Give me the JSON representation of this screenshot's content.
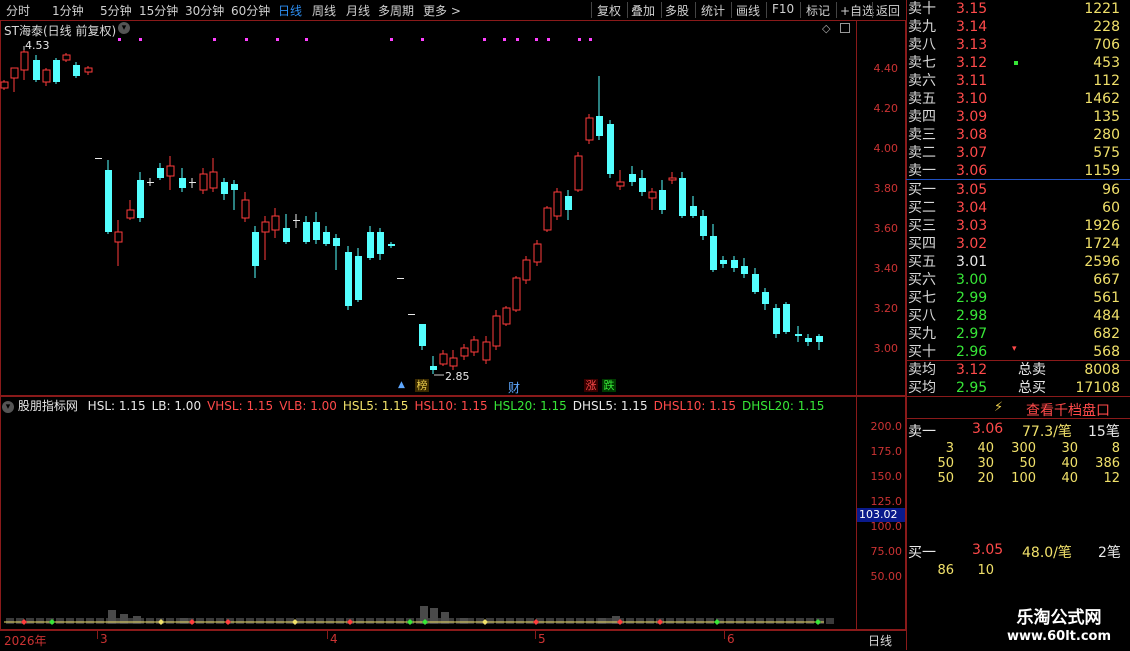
{
  "toolbar": {
    "left_items": [
      "分时",
      "1分钟",
      "5分钟",
      "15分钟",
      "30分钟",
      "60分钟",
      "日线",
      "周线",
      "月线",
      "多周期",
      "更多 >"
    ],
    "active_index": 6,
    "right_items": [
      "复权",
      "叠加",
      "多股",
      "统计",
      "画线",
      "F10",
      "标记",
      "+自选",
      "返回"
    ]
  },
  "main_chart": {
    "title": "ST海泰(日线 前复权)",
    "max_label": "4.53",
    "min_label": "2.85",
    "y_ticks": [
      "4.40",
      "4.20",
      "4.00",
      "3.80",
      "3.60",
      "3.40",
      "3.20",
      "3.00"
    ],
    "events": [
      {
        "text": "榜",
        "color": "#e6c84a"
      },
      {
        "text": "财",
        "color": "#5fa8ff"
      },
      {
        "text": "涨",
        "color": "#ff4a4a"
      },
      {
        "text": "跌",
        "color": "#37e637"
      }
    ]
  },
  "indicator": {
    "name": "股朋指标网",
    "params": [
      {
        "text": "HSL: 1.15",
        "color": "#e8e8e8"
      },
      {
        "text": "LB: 1.00",
        "color": "#e8e8e8"
      },
      {
        "text": "VHSL: 1.15",
        "color": "#ff4a4a"
      },
      {
        "text": "VLB: 1.00",
        "color": "#ff4a4a"
      },
      {
        "text": "HSL5: 1.15",
        "color": "#f0e06a"
      },
      {
        "text": "HSL10: 1.15",
        "color": "#ff4a4a"
      },
      {
        "text": "HSL20: 1.15",
        "color": "#37e637"
      },
      {
        "text": "DHSL5: 1.15",
        "color": "#e8e8e8"
      },
      {
        "text": "DHSL10: 1.15",
        "color": "#ff4a4a"
      },
      {
        "text": "DHSL20: 1.15",
        "color": "#37e637"
      }
    ],
    "y_ticks": [
      "200.0",
      "175.0",
      "150.0",
      "125.0",
      "100.0",
      "75.00",
      "50.00"
    ],
    "current_value": "103.02"
  },
  "x_axis": {
    "labels": [
      "2026年",
      "3",
      "4",
      "5",
      "6"
    ],
    "period_label": "日线"
  },
  "order_book": {
    "asks": [
      {
        "label": "卖十",
        "price": "3.15",
        "vol": "1221"
      },
      {
        "label": "卖九",
        "price": "3.14",
        "vol": "228"
      },
      {
        "label": "卖八",
        "price": "3.13",
        "vol": "706"
      },
      {
        "label": "卖七",
        "price": "3.12",
        "vol": "453"
      },
      {
        "label": "卖六",
        "price": "3.11",
        "vol": "112"
      },
      {
        "label": "卖五",
        "price": "3.10",
        "vol": "1462"
      },
      {
        "label": "卖四",
        "price": "3.09",
        "vol": "135"
      },
      {
        "label": "卖三",
        "price": "3.08",
        "vol": "280"
      },
      {
        "label": "卖二",
        "price": "3.07",
        "vol": "575"
      },
      {
        "label": "卖一",
        "price": "3.06",
        "vol": "1159"
      }
    ],
    "bids": [
      {
        "label": "买一",
        "price": "3.05",
        "vol": "96",
        "color": "red"
      },
      {
        "label": "买二",
        "price": "3.04",
        "vol": "60",
        "color": "red"
      },
      {
        "label": "买三",
        "price": "3.03",
        "vol": "1926",
        "color": "red"
      },
      {
        "label": "买四",
        "price": "3.02",
        "vol": "1724",
        "color": "red"
      },
      {
        "label": "买五",
        "price": "3.01",
        "vol": "2596",
        "color": "white"
      },
      {
        "label": "买六",
        "price": "3.00",
        "vol": "667",
        "color": "green"
      },
      {
        "label": "买七",
        "price": "2.99",
        "vol": "561",
        "color": "green"
      },
      {
        "label": "买八",
        "price": "2.98",
        "vol": "484",
        "color": "green"
      },
      {
        "label": "买九",
        "price": "2.97",
        "vol": "682",
        "color": "green"
      },
      {
        "label": "买十",
        "price": "2.96",
        "vol": "568",
        "color": "green"
      }
    ],
    "summary": [
      {
        "label": "卖均",
        "price": "3.12",
        "label2": "总卖",
        "vol": "8008",
        "color": "red"
      },
      {
        "label": "买均",
        "price": "2.95",
        "label2": "总买",
        "vol": "17108",
        "color": "green"
      }
    ]
  },
  "level_panel": {
    "button": "查看千档盘口",
    "sell1": {
      "label": "卖一",
      "price": "3.06",
      "avg": "77.3/笔",
      "count": "15笔"
    },
    "sell_queue": [
      [
        "3",
        "40",
        "300",
        "30",
        "8"
      ],
      [
        "50",
        "30",
        "50",
        "40",
        "386"
      ],
      [
        "50",
        "20",
        "100",
        "40",
        "12"
      ]
    ],
    "buy1": {
      "label": "买一",
      "price": "3.05",
      "avg": "48.0/笔",
      "count": "2笔"
    },
    "buy_queue": [
      [
        "86",
        "10"
      ]
    ]
  },
  "watermark": {
    "line1": "乐淘公式网",
    "line2": "www.60lt.com"
  }
}
